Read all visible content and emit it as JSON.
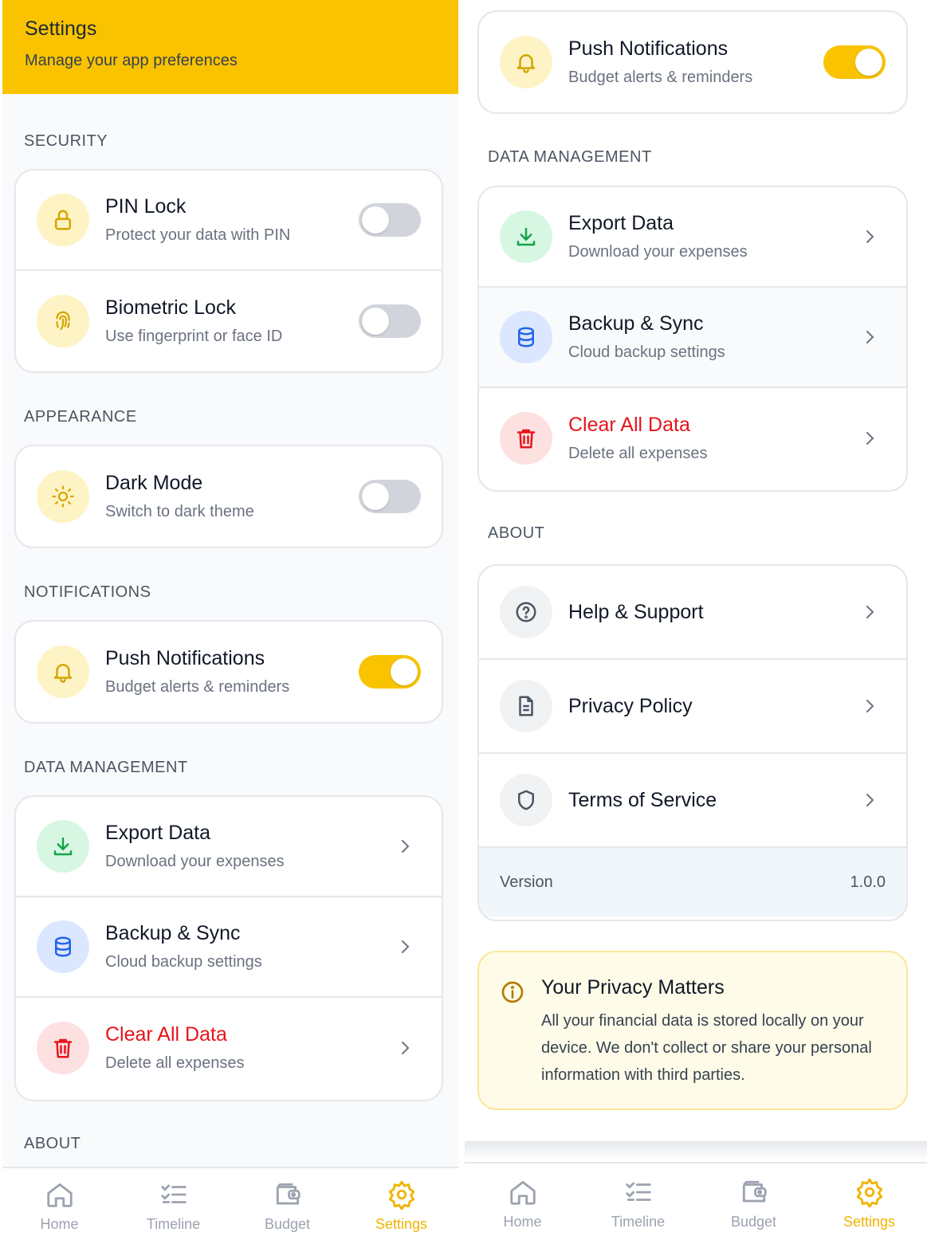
{
  "header": {
    "title": "Settings",
    "subtitle": "Manage your app preferences"
  },
  "sections": {
    "security": "SECURITY",
    "appearance": "APPEARANCE",
    "notifications": "NOTIFICATIONS",
    "data_management": "DATA MANAGEMENT",
    "about": "ABOUT"
  },
  "settings": {
    "pin_lock": {
      "title": "PIN Lock",
      "subtitle": "Protect your data with PIN",
      "enabled": false
    },
    "biometric_lock": {
      "title": "Biometric Lock",
      "subtitle": "Use fingerprint or face ID",
      "enabled": false
    },
    "dark_mode": {
      "title": "Dark Mode",
      "subtitle": "Switch to dark theme",
      "enabled": false
    },
    "push_notifications": {
      "title": "Push Notifications",
      "subtitle": "Budget alerts & reminders",
      "enabled": true
    },
    "export_data": {
      "title": "Export Data",
      "subtitle": "Download your expenses"
    },
    "backup_sync": {
      "title": "Backup & Sync",
      "subtitle": "Cloud backup settings"
    },
    "clear_data": {
      "title": "Clear All Data",
      "subtitle": "Delete all expenses"
    },
    "help": {
      "title": "Help & Support"
    },
    "privacy_policy": {
      "title": "Privacy Policy"
    },
    "terms": {
      "title": "Terms of Service"
    }
  },
  "version": {
    "label": "Version",
    "value": "1.0.0"
  },
  "privacy_notice": {
    "title": "Your Privacy Matters",
    "text": "All your financial data is stored locally on your device. We don't collect or share your personal information with third parties."
  },
  "nav": {
    "home": "Home",
    "timeline": "Timeline",
    "budget": "Budget",
    "settings": "Settings",
    "active": "settings"
  },
  "colors": {
    "accent": "#f9c300",
    "danger": "#e5151b"
  }
}
